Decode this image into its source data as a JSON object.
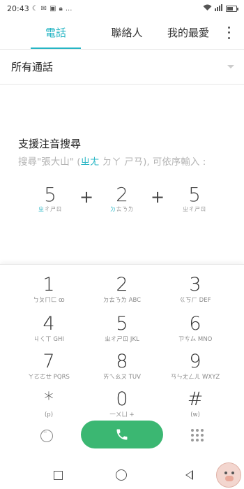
{
  "status_bar": {
    "time": "20:43",
    "icons_left": [
      "moon-icon",
      "email-icon",
      "image-icon",
      "lock-icon"
    ],
    "more": "...",
    "battery_level": 0.7
  },
  "tabs": [
    {
      "label": "電話",
      "active": true
    },
    {
      "label": "聯絡人",
      "active": false
    },
    {
      "label": "我的最愛",
      "active": false
    }
  ],
  "filter": {
    "label": "所有通話"
  },
  "hint": {
    "title": "支援注音搜尋",
    "sub_prefix": "搜尋\"張大山\" (",
    "zhuyin_1": "ㄓㄤ",
    "zhuyin_2": "ㄉㄚ",
    "zhuyin_3": "ㄕㄢ",
    "sub_suffix": "), 可依序輸入 :"
  },
  "example": {
    "keys": [
      {
        "num": "5",
        "hl": "ㄓ",
        "rest": "ㄔㄕㄖ"
      },
      {
        "num": "2",
        "hl": "ㄉ",
        "rest": "ㄊㄋㄌ"
      },
      {
        "num": "5",
        "hl": "",
        "rest": "ㄓㄔㄕㄖ"
      }
    ],
    "plus": "+"
  },
  "keypad": {
    "keys": [
      {
        "num": "1",
        "sub": "ㄅㄆㄇㄈ  ꝏ"
      },
      {
        "num": "2",
        "sub": "ㄉㄊㄋㄌ ABC"
      },
      {
        "num": "3",
        "sub": "ㄍㄎㄏ DEF"
      },
      {
        "num": "4",
        "sub": "ㄐㄑㄒ GHI"
      },
      {
        "num": "5",
        "sub": "ㄓㄔㄕㄖ JKL"
      },
      {
        "num": "6",
        "sub": "ㄗㄘㄙ MNO"
      },
      {
        "num": "7",
        "sub": "ㄚㄛㄜㄝ PQRS"
      },
      {
        "num": "8",
        "sub": "ㄞㄟㄠㄡ TUV"
      },
      {
        "num": "9",
        "sub": "ㄢㄣㄤㄥㄦ WXYZ"
      },
      {
        "num": "*",
        "sub": "(p)"
      },
      {
        "num": "0",
        "sub": "一ㄨㄩ +"
      },
      {
        "num": "#",
        "sub": "(w)"
      }
    ]
  },
  "colors": {
    "accent": "#26b5c4",
    "dial": "#3bb772"
  }
}
